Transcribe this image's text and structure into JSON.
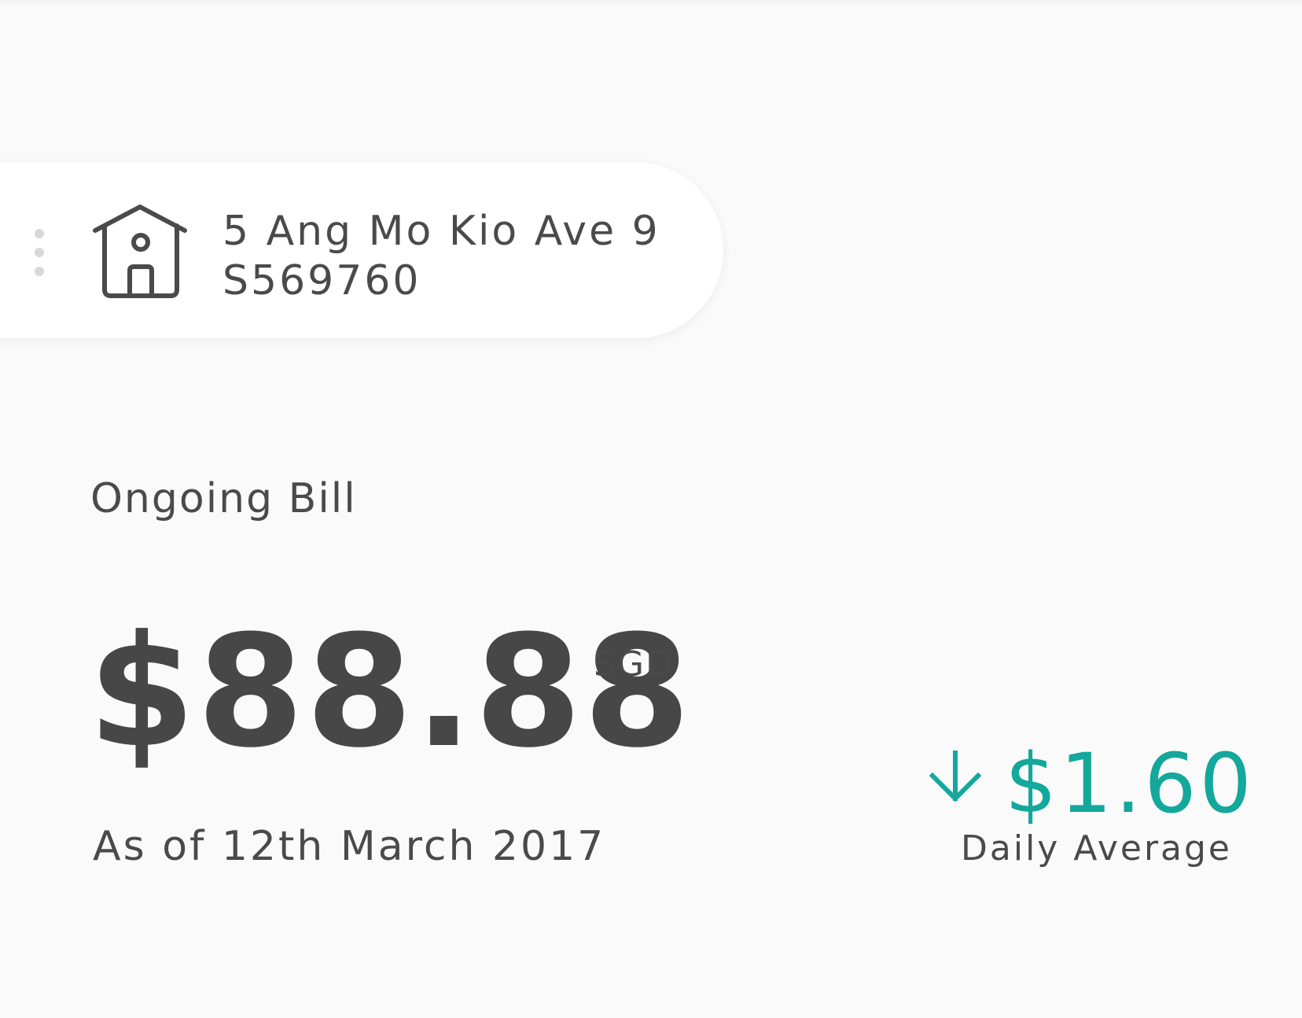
{
  "address": {
    "line1": "5 Ang Mo Kio Ave 9",
    "line2": "S569760",
    "icon": "house-icon",
    "menu_icon": "vertical-dots-icon"
  },
  "bill": {
    "label": "Ongoing Bill",
    "amount": "$88.88",
    "currency": "SGD",
    "as_of": "As of 12th March 2017"
  },
  "daily_average": {
    "value": "$1.60",
    "label": "Daily Average",
    "trend_icon": "arrow-down-icon",
    "accent_color": "#13a89b"
  },
  "colors": {
    "text": "#4a4a4a",
    "background": "#fafafa",
    "card": "#ffffff"
  }
}
